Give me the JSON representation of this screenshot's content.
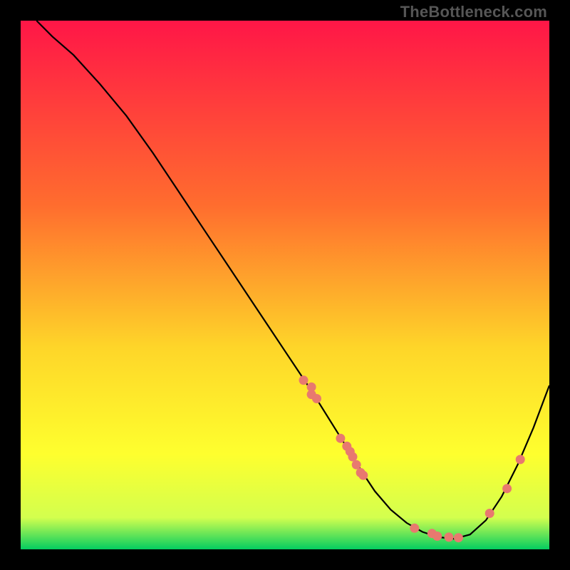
{
  "watermark": "TheBottleneck.com",
  "colors": {
    "gradient_top": "#ff1647",
    "gradient_mid1": "#ff6d2e",
    "gradient_mid2": "#fed629",
    "gradient_mid3": "#feff2e",
    "gradient_mid4": "#d3ff4e",
    "gradient_bottom": "#04cd60",
    "curve": "#000000",
    "dot": "#e8796f"
  },
  "chart_data": {
    "type": "line",
    "title": "",
    "xlabel": "",
    "ylabel": "",
    "xlim": [
      0,
      100
    ],
    "ylim": [
      0,
      100
    ],
    "curve": {
      "x": [
        3,
        6,
        10,
        15,
        20,
        25,
        30,
        35,
        40,
        45,
        50,
        55,
        60,
        65,
        67,
        70,
        73,
        76,
        79,
        82,
        85,
        88,
        91,
        94,
        97,
        100
      ],
      "y": [
        100,
        97,
        93.5,
        88,
        82,
        75,
        67.5,
        60,
        52.5,
        45,
        37.5,
        30,
        22,
        14,
        11,
        7.5,
        5,
        3.3,
        2.3,
        2,
        2.8,
        5.5,
        10,
        16,
        23,
        31
      ]
    },
    "series": [
      {
        "name": "dots",
        "points": [
          {
            "x": 53.5,
            "y": 32
          },
          {
            "x": 55.0,
            "y": 30.7
          },
          {
            "x": 55.0,
            "y": 29.3
          },
          {
            "x": 56.0,
            "y": 28.5
          },
          {
            "x": 60.5,
            "y": 21.0
          },
          {
            "x": 61.7,
            "y": 19.5
          },
          {
            "x": 62.3,
            "y": 18.5
          },
          {
            "x": 62.8,
            "y": 17.5
          },
          {
            "x": 63.5,
            "y": 16.0
          },
          {
            "x": 64.3,
            "y": 14.5
          },
          {
            "x": 64.8,
            "y": 14.0
          },
          {
            "x": 74.5,
            "y": 4.0
          },
          {
            "x": 77.8,
            "y": 3.0
          },
          {
            "x": 78.8,
            "y": 2.5
          },
          {
            "x": 81.0,
            "y": 2.3
          },
          {
            "x": 82.8,
            "y": 2.2
          },
          {
            "x": 88.7,
            "y": 6.8
          },
          {
            "x": 92.0,
            "y": 11.5
          },
          {
            "x": 94.5,
            "y": 17.0
          }
        ]
      }
    ]
  }
}
